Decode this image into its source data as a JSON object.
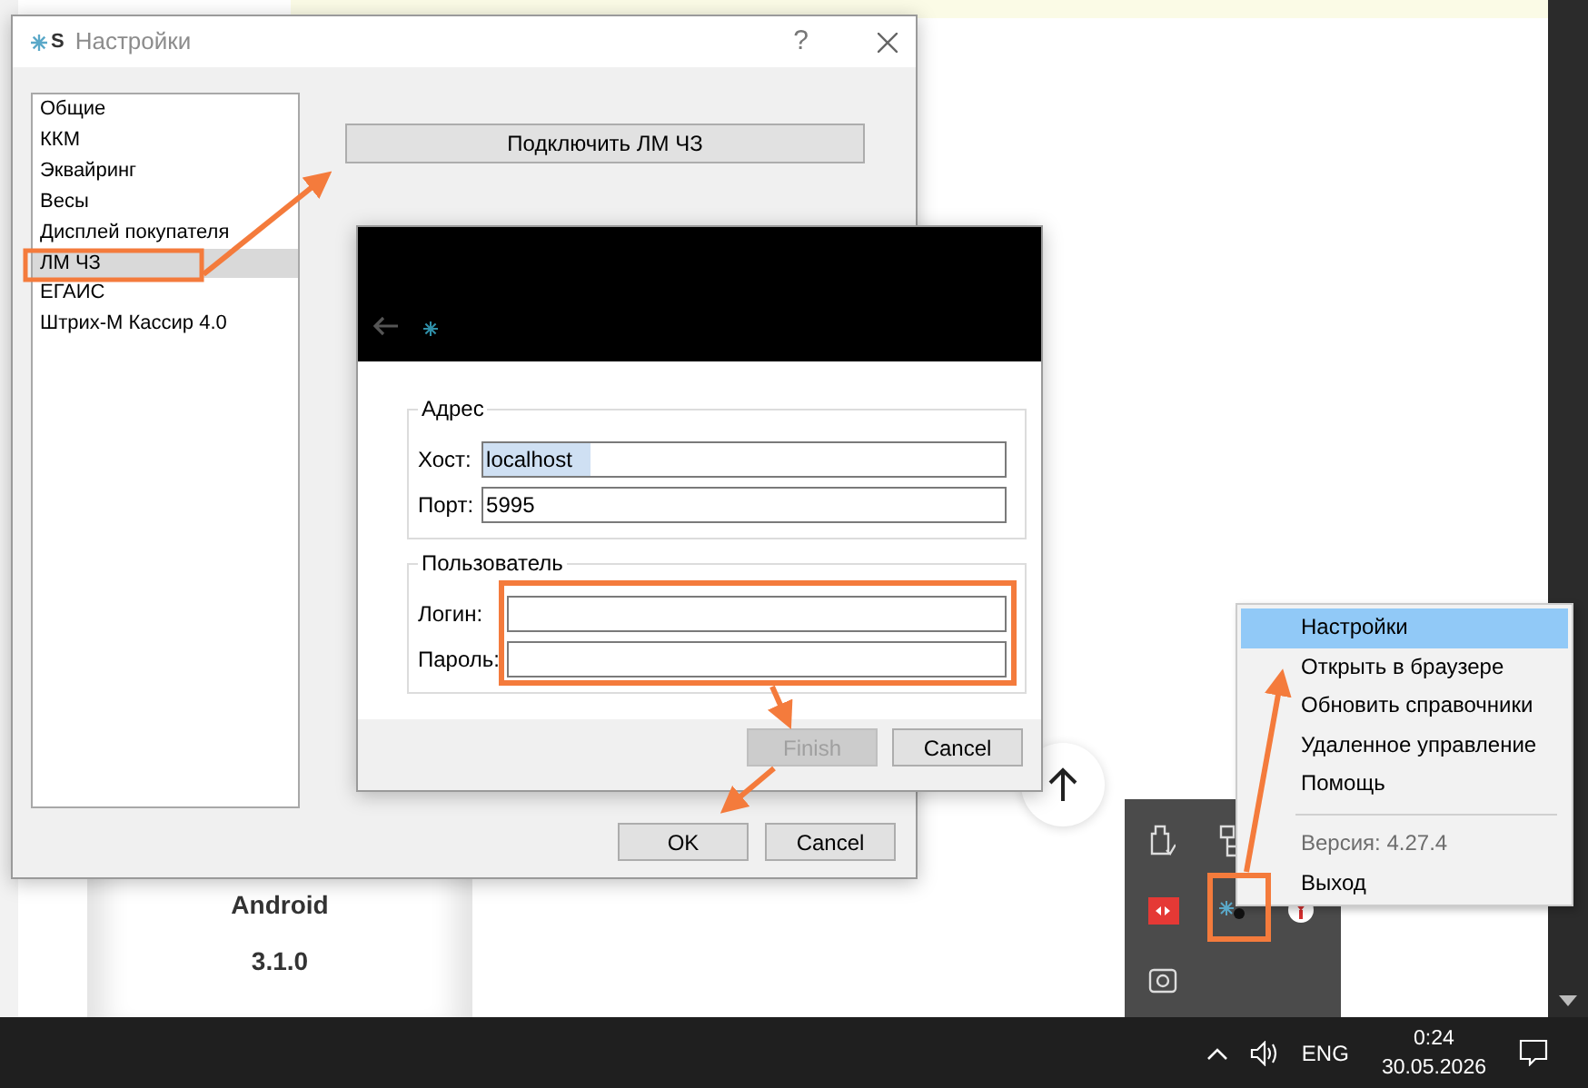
{
  "background_page": {
    "card": {
      "title": "Android",
      "version": "3.1.0"
    }
  },
  "settings_dialog": {
    "logo_letter": "S",
    "title": "Настройки",
    "help": "?",
    "categories": [
      {
        "label": "Общие",
        "selected": false
      },
      {
        "label": "ККМ",
        "selected": false
      },
      {
        "label": "Эквайринг",
        "selected": false
      },
      {
        "label": "Весы",
        "selected": false
      },
      {
        "label": "Дисплей покупателя",
        "selected": false
      },
      {
        "label": "ЛМ ЧЗ",
        "selected": true
      },
      {
        "label": "ЕГАИС",
        "selected": false
      },
      {
        "label": "Штрих-М Кассир 4.0",
        "selected": false
      }
    ],
    "connect_button": "Подключить ЛМ ЧЗ",
    "buttons": [
      "OK",
      "Cancel"
    ]
  },
  "wizard": {
    "groups": [
      {
        "title": "Адрес",
        "fields": [
          {
            "label": "Хост:",
            "value": "localhost",
            "highlighted": true
          },
          {
            "label": "Порт:",
            "value": "5995",
            "highlighted": false
          }
        ]
      },
      {
        "title": "Пользователь",
        "fields": [
          {
            "label": "Логин:"
          },
          {
            "label": "Пароль:"
          }
        ]
      }
    ],
    "buttons": [
      {
        "label": "Finish",
        "disabled": true
      },
      {
        "label": "Cancel",
        "disabled": false
      }
    ]
  },
  "tray_menu": {
    "items": [
      {
        "kind": "item",
        "label": "Настройки",
        "selected": true,
        "disabled": false
      },
      {
        "kind": "item",
        "label": "Открыть в браузере",
        "selected": false,
        "disabled": false
      },
      {
        "kind": "item",
        "label": "Обновить справочники",
        "selected": false,
        "disabled": false
      },
      {
        "kind": "item",
        "label": "Удаленное управление",
        "selected": false,
        "disabled": false
      },
      {
        "kind": "item",
        "label": "Помощь",
        "selected": false,
        "disabled": false
      },
      {
        "kind": "separator"
      },
      {
        "kind": "item",
        "label": "Версия: 4.27.4",
        "selected": false,
        "disabled": true
      },
      {
        "kind": "item",
        "label": "Выход",
        "selected": false,
        "disabled": false
      }
    ]
  },
  "taskbar": {
    "language": "ENG",
    "time": "0:24",
    "date": "30.05.2026"
  }
}
